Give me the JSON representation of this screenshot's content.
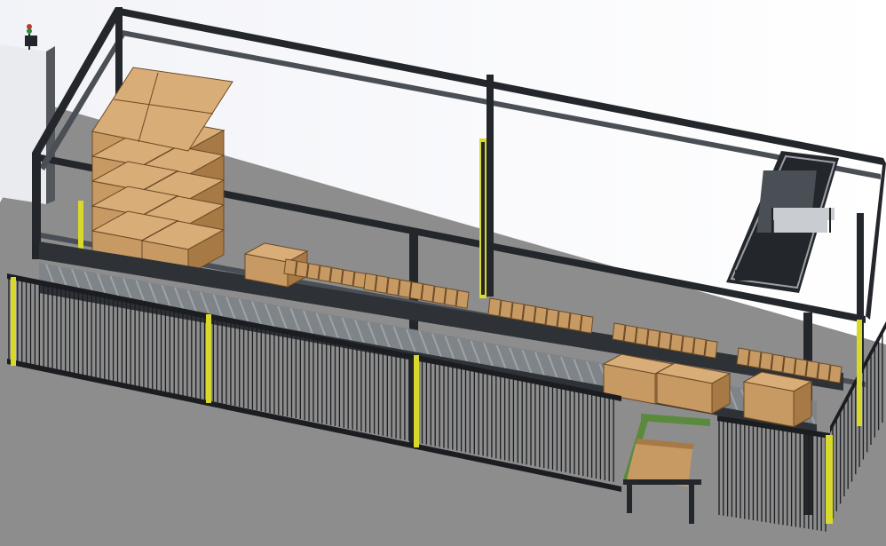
{
  "scene": {
    "kind": "cad-render",
    "subject": "palletizing-gantry-cell",
    "colors": {
      "background_top": "#f2f3f8",
      "background_bottom": "#ffffff",
      "floor": "#8d8d8d",
      "frame": "#4a4f55",
      "frame_dark": "#23262a",
      "carton": "#c89a63",
      "carton_shadow": "#a77a45",
      "carton_line": "#6b4a25",
      "rail": "#2e3136",
      "roller": "#9ea3a8",
      "fence": "#1b1d20",
      "safety_yellow": "#d8d92a",
      "green_frame": "#5a8a3c",
      "panel": "#e9ebee",
      "beacon_red": "#c0392b",
      "beacon_green": "#2e8b3e"
    }
  }
}
